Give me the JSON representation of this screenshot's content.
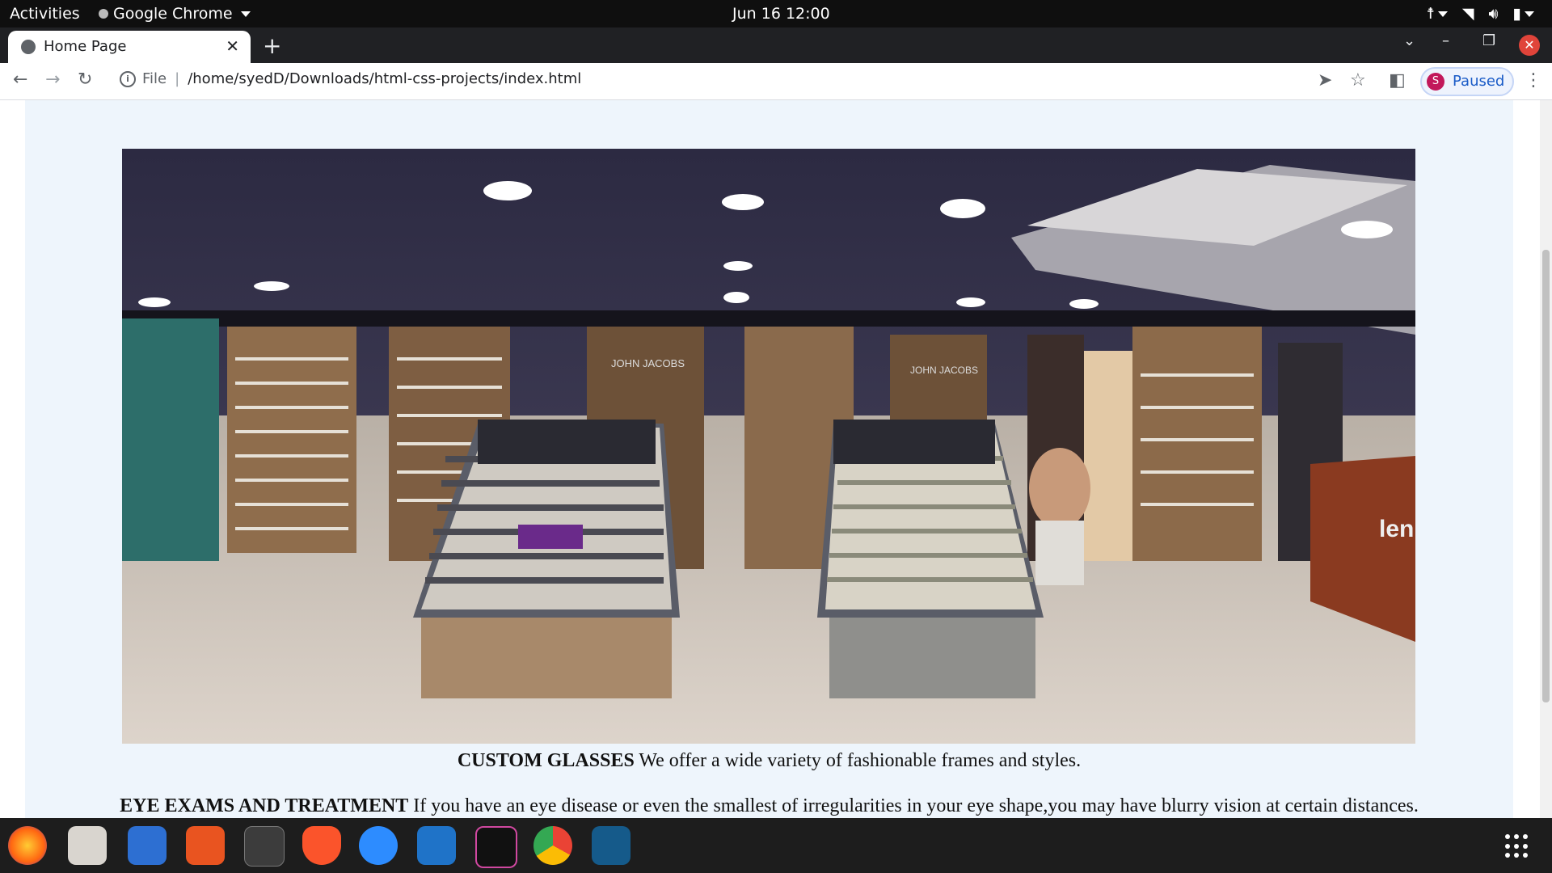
{
  "topbar": {
    "activities": "Activities",
    "app_name": "Google Chrome",
    "clock": "Jun 16  12:00"
  },
  "browser": {
    "tab_title": "Home Page",
    "omnibox_scheme": "File",
    "url": "/home/syedD/Downloads/html-css-projects/index.html",
    "profile_initial": "S",
    "profile_status": "Paused"
  },
  "page": {
    "custom_glasses_heading": "CUSTOM GLASSES",
    "custom_glasses_text": " We offer a wide variety of fashionable frames and styles.",
    "eye_exams_heading": "EYE EXAMS AND TREATMENT",
    "eye_exams_text": " If you have an eye disease or even the smallest of irregularities in your eye shape,you may have blurry vision at certain distances.",
    "store_sign_1": "JOHN JACOBS",
    "store_sign_2": "JOHN JACOBS",
    "store_sign_3": "len"
  },
  "dock": {
    "apps": [
      "firefox-icon",
      "files-icon",
      "text-editor-icon",
      "software-center-icon",
      "terminal-icon",
      "brave-icon",
      "zoom-icon",
      "vscode-icon",
      "intellij-icon",
      "chrome-icon",
      "mysql-workbench-icon"
    ]
  }
}
